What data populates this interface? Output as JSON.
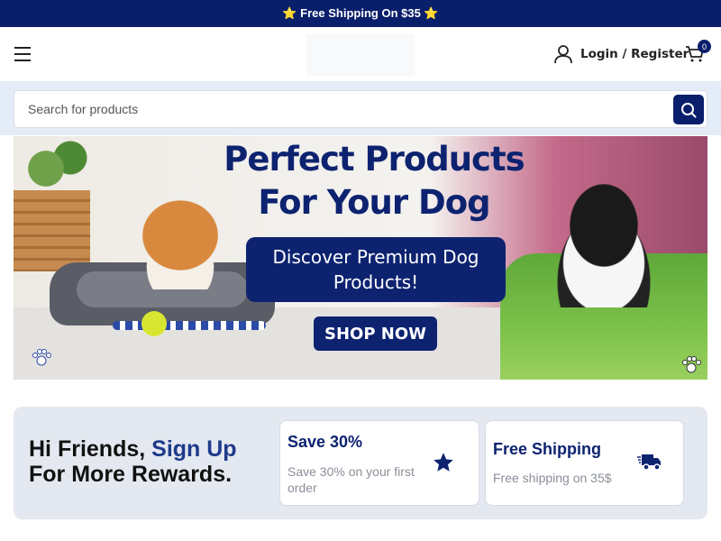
{
  "topbar": {
    "text": "⭐ Free Shipping On $35 ⭐"
  },
  "header": {
    "menu_icon": "hamburger-icon",
    "login_label": "Login / Register",
    "user_icon": "user-icon",
    "cart_icon": "cart-icon",
    "cart_count": "0"
  },
  "search": {
    "placeholder": "Search for products",
    "value": "",
    "button_icon": "search-icon"
  },
  "banner": {
    "title_line1": "Perfect Products",
    "title_line2": "For Your Dog",
    "subtitle_line1": "Discover Premium Dog",
    "subtitle_line2": "Products!",
    "cta": "SHOP NOW",
    "paw_icon": "paw-icon"
  },
  "promo": {
    "heading_prefix": "Hi Friends, ",
    "heading_link": "Sign Up",
    "heading_line2": "For More Rewards.",
    "cards": [
      {
        "title": "Save 30%",
        "desc": "Save 30% on your first order",
        "icon": "star-icon"
      },
      {
        "title": "Free Shipping",
        "desc": "Free shipping on 35$",
        "icon": "delivery-truck-icon"
      }
    ]
  },
  "colors": {
    "brand_navy": "#0a1f6b",
    "search_band": "#e4ecf8",
    "promo_bg": "#e4e8f0"
  }
}
